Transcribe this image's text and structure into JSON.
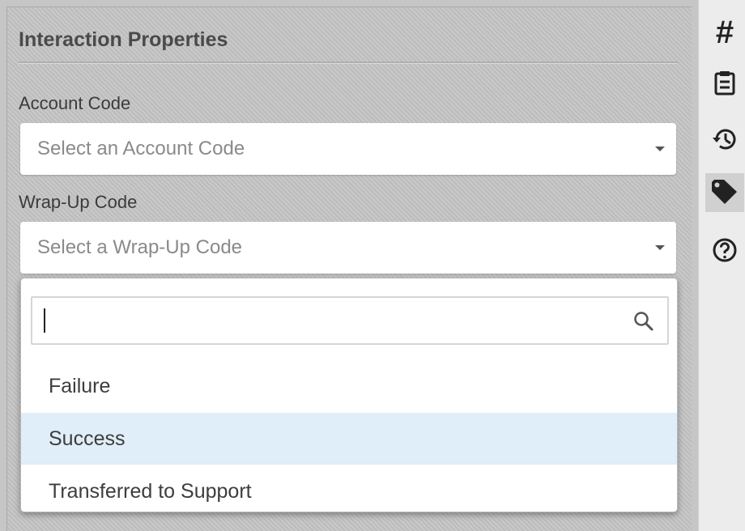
{
  "panel": {
    "title": "Interaction Properties",
    "account_code": {
      "label": "Account Code",
      "placeholder": "Select an Account Code"
    },
    "wrapup_code": {
      "label": "Wrap-Up Code",
      "placeholder": "Select a Wrap-Up Code"
    },
    "dropdown": {
      "search_value": "",
      "options": [
        {
          "label": "Failure",
          "highlighted": false
        },
        {
          "label": "Success",
          "highlighted": true
        },
        {
          "label": "Transferred to Support",
          "highlighted": false
        }
      ]
    }
  },
  "right_toolbar": {
    "icons": [
      "hash-icon",
      "clipboard-icon",
      "history-icon",
      "tag-icon",
      "help-icon"
    ],
    "active": "tag-icon",
    "hash_glyph": "#"
  },
  "colors": {
    "panel_bg": "#c4c4c4",
    "highlight": "#dfeef8",
    "toolbar_bg": "#ececec"
  }
}
